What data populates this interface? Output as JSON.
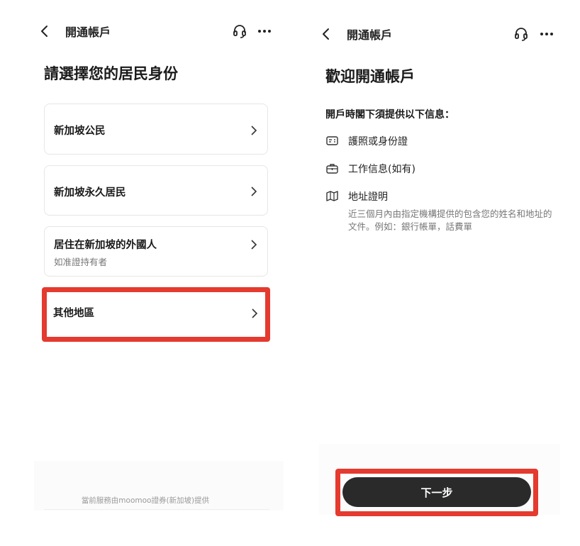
{
  "left_screen": {
    "nav": {
      "title": "開通帳戶"
    },
    "title": "請選擇您的居民身份",
    "options": [
      {
        "label": "新加坡公民",
        "sub": ""
      },
      {
        "label": "新加坡永久居民",
        "sub": ""
      },
      {
        "label": "居住在新加坡的外國人",
        "sub": "如准證持有者"
      },
      {
        "label": "其他地區",
        "sub": ""
      }
    ],
    "footer": "當前服務由moomoo證券(新加坡)提供"
  },
  "right_screen": {
    "nav": {
      "title": "開通帳戶"
    },
    "title": "歡迎開通帳戶",
    "info_heading": "開戶時閣下須提供以下信息：",
    "requirements": [
      {
        "icon": "id-card-icon",
        "label": "護照或身份證"
      },
      {
        "icon": "briefcase-icon",
        "label": "工作信息(如有)"
      },
      {
        "icon": "map-icon",
        "label": "地址證明",
        "desc": "近三個月內由指定機構提供的包含您的姓名和地址的文件。例如：銀行帳單，話費單"
      }
    ],
    "next_button": "下一步"
  },
  "colors": {
    "highlight": "#e53a2f",
    "button_bg": "#2a2a2b",
    "card_border": "#e6e6e6"
  }
}
